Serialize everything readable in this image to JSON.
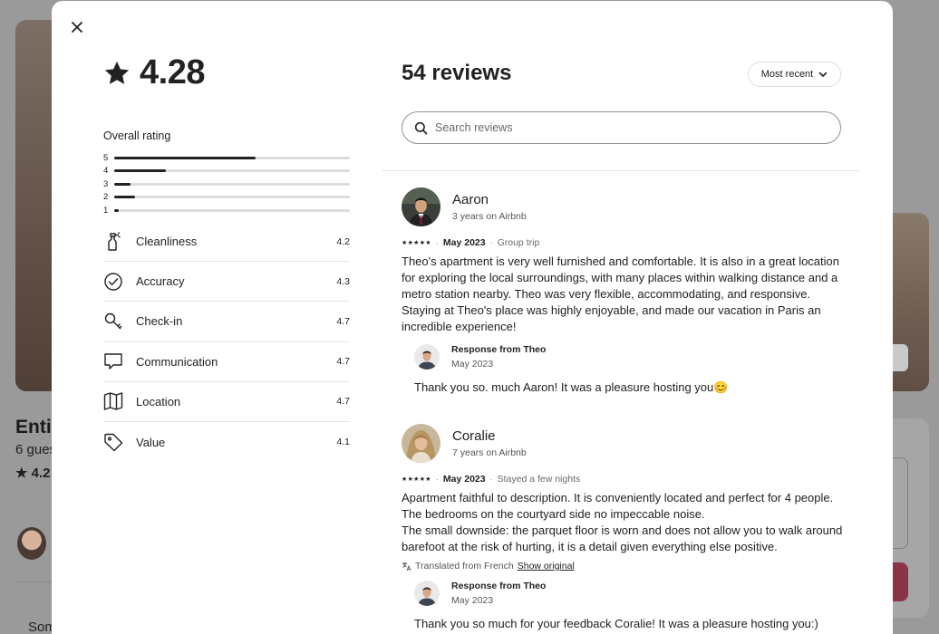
{
  "background": {
    "title": "Enti",
    "subtitle": "6 gues",
    "rating": "4.2",
    "bottom_text": "Som"
  },
  "modal": {
    "close_icon": "close-icon",
    "overall": {
      "score": "4.28",
      "label": "Overall rating",
      "distribution": [
        {
          "stars": "5",
          "fraction": 0.6
        },
        {
          "stars": "4",
          "fraction": 0.22
        },
        {
          "stars": "3",
          "fraction": 0.07
        },
        {
          "stars": "2",
          "fraction": 0.09
        },
        {
          "stars": "1",
          "fraction": 0.02
        }
      ]
    },
    "categories": [
      {
        "label": "Cleanliness",
        "score": "4.2",
        "icon": "spray-bottle-icon"
      },
      {
        "label": "Accuracy",
        "score": "4.3",
        "icon": "check-circle-icon"
      },
      {
        "label": "Check-in",
        "score": "4.7",
        "icon": "key-icon"
      },
      {
        "label": "Communication",
        "score": "4.7",
        "icon": "message-icon"
      },
      {
        "label": "Location",
        "score": "4.7",
        "icon": "map-icon"
      },
      {
        "label": "Value",
        "score": "4.1",
        "icon": "tag-icon"
      }
    ],
    "reviews_header": {
      "title": "54 reviews",
      "sort_label": "Most recent",
      "search_placeholder": "Search reviews"
    },
    "reviews": [
      {
        "name": "Aaron",
        "tenure": "3 years on Airbnb",
        "stars": "★★★★★",
        "date": "May 2023",
        "trip_type": "Group trip",
        "text": "Theo's apartment is very well furnished and comfortable. It is also in a great location for exploring the local surroundings, with many places within walking distance and a metro station nearby. Theo was very flexible, accommodating, and responsive. Staying at Theo's place was highly enjoyable, and made our vacation in Paris an incredible experience!",
        "response": {
          "title": "Response from Theo",
          "date": "May 2023",
          "text": "Thank you so. much Aaron! It was a pleasure hosting you😊"
        }
      },
      {
        "name": "Coralie",
        "tenure": "7 years on Airbnb",
        "stars": "★★★★★",
        "date": "May 2023",
        "trip_type": "Stayed a few nights",
        "text_lines": [
          "Apartment faithful to description. It is conveniently located and perfect for 4 people. The bedrooms on the courtyard side no impeccable noise.",
          "The small downside: the parquet floor is worn and does not allow you to walk around barefoot at the risk of hurting, it is a detail given everything else positive."
        ],
        "translated_note": "Translated from French",
        "show_original": "Show original",
        "response": {
          "title": "Response from Theo",
          "date": "May 2023",
          "text": "Thank you so much for your feedback Coralie! It was a pleasure hosting you:)"
        }
      }
    ]
  }
}
